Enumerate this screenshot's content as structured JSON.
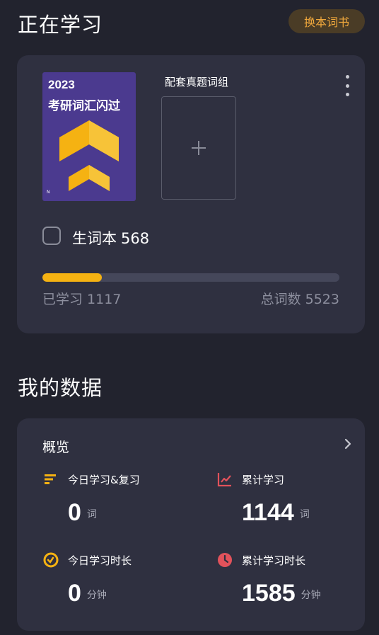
{
  "header": {
    "title": "正在学习",
    "change_book_label": "换本词书"
  },
  "study_card": {
    "book": {
      "year": "2023",
      "name": "考研词汇闪过",
      "corner_mark": "N",
      "cover_color": "#4b3a8f",
      "logo_color": "#f5b212"
    },
    "set_label": "配套真题词组",
    "add_icon": "plus-icon",
    "more_icon": "more-vertical-icon",
    "vocab_book": {
      "label": "生词本",
      "count": "568"
    },
    "progress": {
      "fraction": 0.2,
      "learned_label": "已学习 1117",
      "total_label": "总词数 5523"
    }
  },
  "data_section": {
    "title": "我的数据",
    "overview_title": "概览",
    "stats": {
      "today_study": {
        "icon": "list-icon",
        "color": "#f5b212",
        "label": "今日学习&复习",
        "value": "0",
        "unit": "词"
      },
      "total_study": {
        "icon": "line-chart-icon",
        "color": "#e2525b",
        "label": "累计学习",
        "value": "1144",
        "unit": "词"
      },
      "today_time": {
        "icon": "timer-icon",
        "color": "#f5b212",
        "label": "今日学习时长",
        "value": "0",
        "unit": "分钟"
      },
      "total_time": {
        "icon": "clock-icon",
        "color": "#e2525b",
        "label": "累计学习时长",
        "value": "1585",
        "unit": "分钟"
      }
    }
  }
}
